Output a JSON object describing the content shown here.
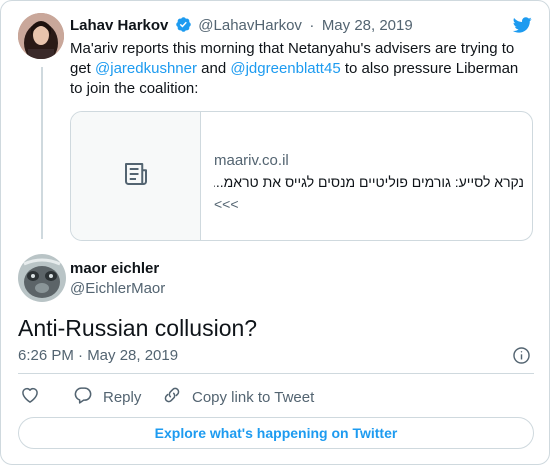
{
  "brand": {
    "accent": "#1d9bf0",
    "text_secondary": "#536471",
    "border": "#cfd9de",
    "logo_icon": "twitter-bird-icon"
  },
  "quoted_tweet": {
    "author_name": "Lahav Harkov",
    "verified_icon": "verified-badge-icon",
    "handle": "@LahavHarkov",
    "separator": "·",
    "date": "May 28, 2019",
    "text_parts": [
      "Ma'ariv reports this morning that Netanyahu's advisers are trying to get ",
      "@jaredkushner",
      " and ",
      "@jdgreenblatt45",
      " to also pressure Liberman to join the coalition:"
    ],
    "link_card": {
      "thumb_icon": "article-icon",
      "domain": "maariv.co.il",
      "title": "נקרא לסייע: גורמים פוליטיים מנסים לגייס את טראמ...",
      "description": "<<<"
    }
  },
  "main_tweet": {
    "author_name": "maor eichler",
    "handle": "@EichlerMaor",
    "text": "Anti-Russian collusion?",
    "timestamp": "6:26 PM · May 28, 2019",
    "info_icon": "info-icon"
  },
  "actions": {
    "like_icon": "heart-icon",
    "reply_label": "Reply",
    "reply_icon": "reply-icon",
    "copy_link_label": "Copy link to Tweet",
    "copy_link_icon": "link-icon"
  },
  "explore_label": "Explore what's happening on Twitter"
}
